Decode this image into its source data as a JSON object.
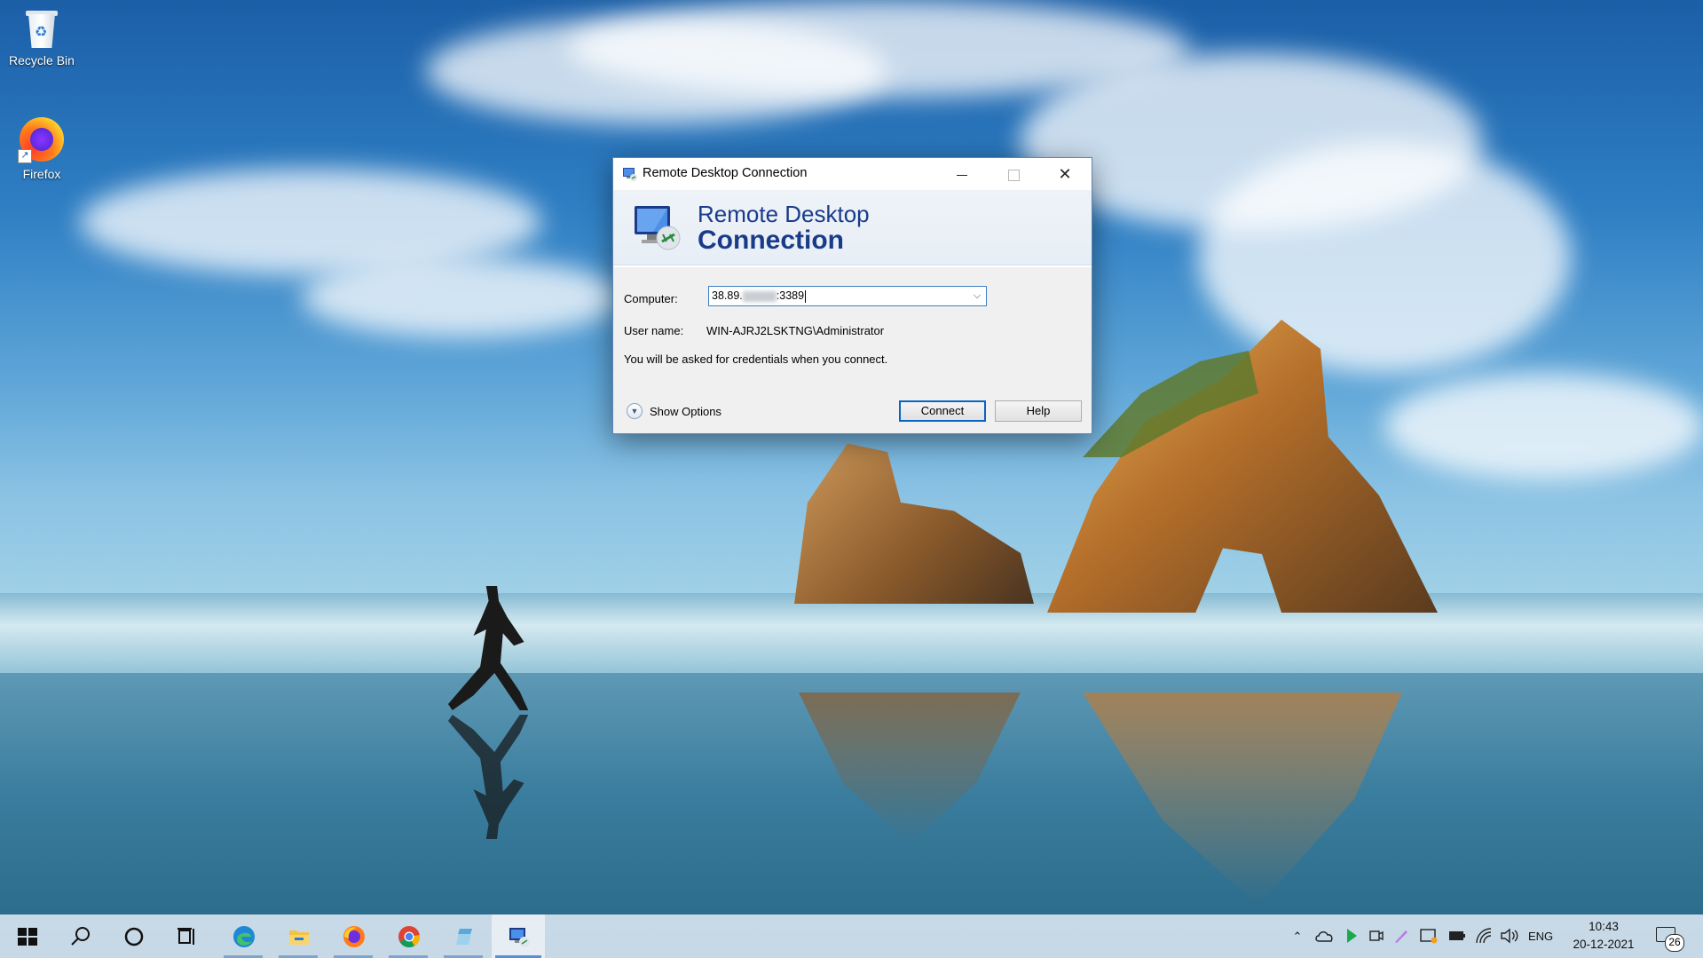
{
  "desktop": {
    "icons": [
      {
        "label": "Recycle Bin"
      },
      {
        "label": "Firefox"
      }
    ]
  },
  "dialog": {
    "window_title": "Remote Desktop Connection",
    "banner_line1": "Remote Desktop",
    "banner_line2": "Connection",
    "computer_label": "Computer:",
    "computer_value_prefix": "38.89.",
    "computer_value_suffix": ":3389",
    "username_label": "User name:",
    "username_value": "WIN-AJRJ2LSKTNG\\Administrator",
    "info_text": "You will be asked for credentials when you connect.",
    "show_options_label": "Show Options",
    "connect_label": "Connect",
    "help_label": "Help"
  },
  "taskbar": {
    "apps": [
      "start-icon",
      "search-icon",
      "cortana-icon",
      "task-view-icon",
      "edge-icon",
      "file-explorer-icon",
      "firefox-icon",
      "chrome-icon",
      "notepad-icon",
      "remote-desktop-icon"
    ],
    "language": "ENG",
    "time": "10:43",
    "date": "20-12-2021",
    "notification_count": "26"
  },
  "colors": {
    "accent": "#0a64c4",
    "banner_text": "#1a3b8a"
  }
}
